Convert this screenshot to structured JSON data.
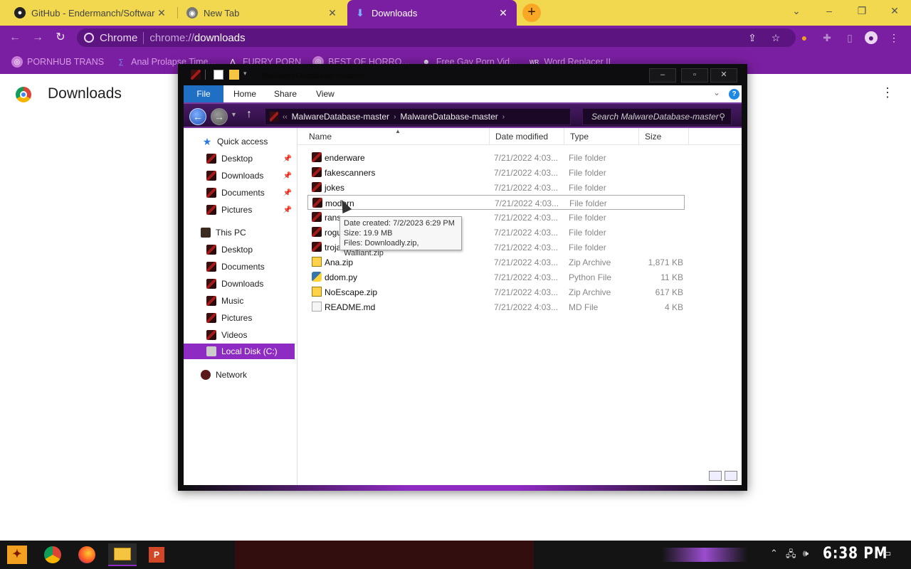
{
  "browser": {
    "tabs": [
      {
        "label": "GitHub - Endermanch/Softwar",
        "icon": "github-icon",
        "active": false
      },
      {
        "label": "New Tab",
        "icon": "chrome-icon",
        "active": false
      },
      {
        "label": "Downloads",
        "icon": "download-icon",
        "active": true
      }
    ],
    "window_controls": {
      "minimize": "–",
      "restore": "❐",
      "close": "✕",
      "tab_search": "⌄"
    },
    "omnibox": {
      "site_label": "Chrome",
      "url_scheme": "chrome://",
      "url_host": "downloads"
    },
    "bookmarks": [
      {
        "label": "PORNHUB TRANS",
        "icon": "globe-icon"
      },
      {
        "label": "Anal Prolapse Time...",
        "icon": "bookmark-icon"
      },
      {
        "label": "FURRY PORN",
        "icon": "triangle-icon"
      },
      {
        "label": "BEST OF HORRO...",
        "icon": "globe-icon"
      },
      {
        "label": "Free Gay Porn Vid...",
        "icon": "site-icon"
      },
      {
        "label": "Word Replacer II",
        "icon": "wr-icon"
      }
    ]
  },
  "downloads_page": {
    "title": "Downloads"
  },
  "explorer": {
    "title": "MalwareDatabase-master",
    "ribbon_tabs": [
      "File",
      "Home",
      "Share",
      "View"
    ],
    "help": "?",
    "breadcrumb": [
      "MalwareDatabase-master",
      "MalwareDatabase-master"
    ],
    "search_placeholder": "Search MalwareDatabase-master",
    "nav": {
      "quick_access": "Quick access",
      "quick_items": [
        "Desktop",
        "Downloads",
        "Documents",
        "Pictures"
      ],
      "this_pc": "This PC",
      "pc_items": [
        "Desktop",
        "Documents",
        "Downloads",
        "Music",
        "Pictures",
        "Videos"
      ],
      "local_disk": "Local Disk (C:)",
      "network": "Network"
    },
    "columns": {
      "name": "Name",
      "date": "Date modified",
      "type": "Type",
      "size": "Size"
    },
    "files": [
      {
        "name": "enderware",
        "date": "7/21/2022 4:03...",
        "type": "File folder",
        "size": ""
      },
      {
        "name": "fakescanners",
        "date": "7/21/2022 4:03...",
        "type": "File folder",
        "size": ""
      },
      {
        "name": "jokes",
        "date": "7/21/2022 4:03...",
        "type": "File folder",
        "size": ""
      },
      {
        "name": "modern",
        "date": "7/21/2022 4:03...",
        "type": "File folder",
        "size": ""
      },
      {
        "name": "rans",
        "date": "7/21/2022 4:03...",
        "type": "File folder",
        "size": ""
      },
      {
        "name": "rogu",
        "date": "7/21/2022 4:03...",
        "type": "File folder",
        "size": ""
      },
      {
        "name": "troja",
        "date": "7/21/2022 4:03...",
        "type": "File folder",
        "size": ""
      },
      {
        "name": "Ana.zip",
        "date": "7/21/2022 4:03...",
        "type": "Zip Archive",
        "size": "1,871 KB"
      },
      {
        "name": "ddom.py",
        "date": "7/21/2022 4:03...",
        "type": "Python File",
        "size": "11 KB"
      },
      {
        "name": "NoEscape.zip",
        "date": "7/21/2022 4:03...",
        "type": "Zip Archive",
        "size": "617 KB"
      },
      {
        "name": "README.md",
        "date": "7/21/2022 4:03...",
        "type": "MD File",
        "size": "4 KB"
      }
    ],
    "tooltip": {
      "line1": "Date created: 7/2/2023 6:29 PM",
      "line2": "Size: 19.9 MB",
      "line3": "Files: Downloadly.zip, Walliant.zip"
    }
  },
  "taskbar": {
    "clock": "6:38 PM"
  },
  "colors": {
    "tab_strip": "#f2d84e",
    "toolbar": "#7b1fa2",
    "selection": "#8e2bc2",
    "file_tab": "#1f6fc5"
  }
}
